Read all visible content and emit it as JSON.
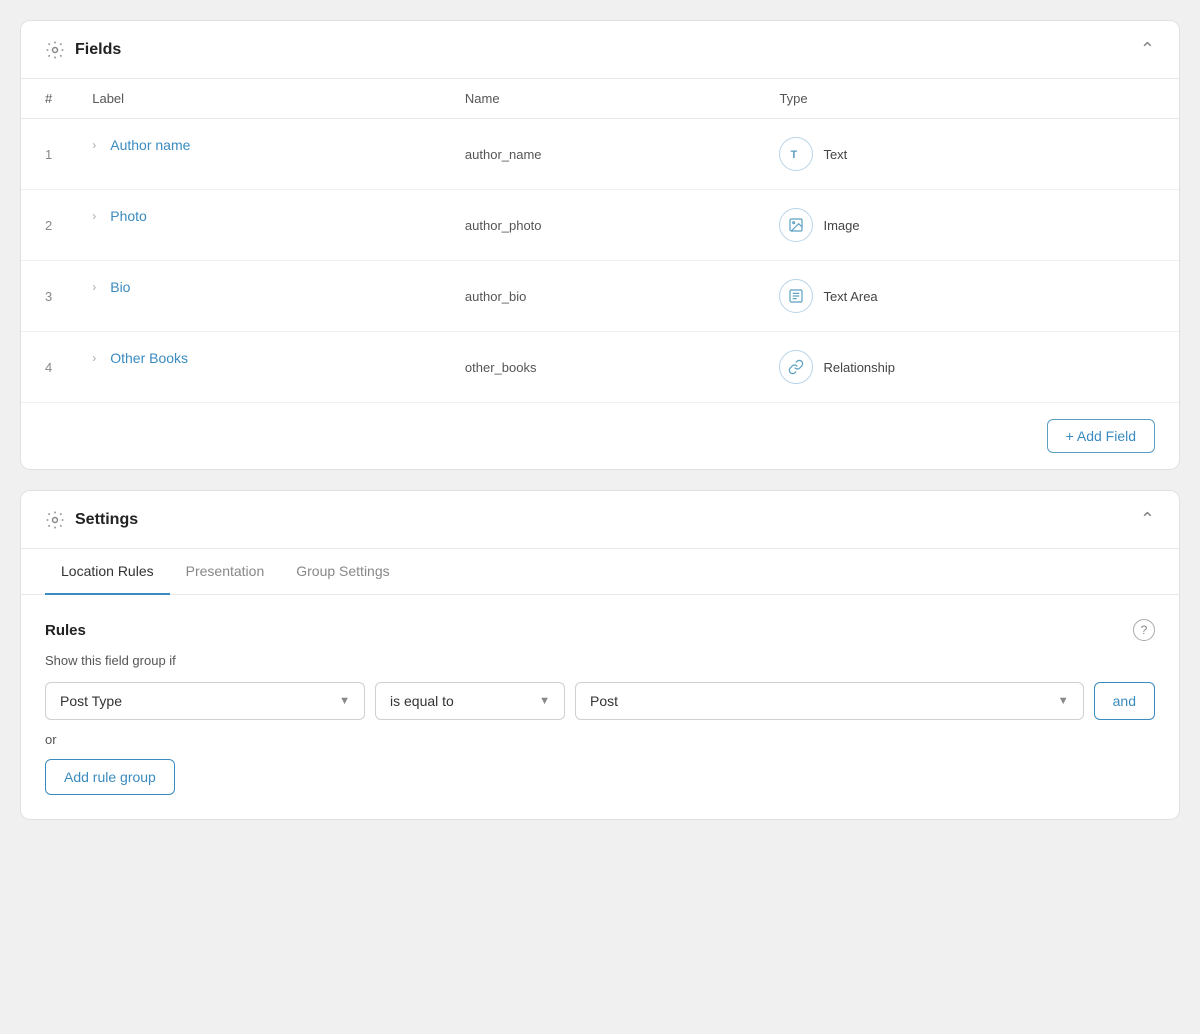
{
  "fields_panel": {
    "title": "Fields",
    "columns": {
      "hash": "#",
      "label": "Label",
      "name": "Name",
      "type": "Type"
    },
    "rows": [
      {
        "number": "1",
        "label": "Author name",
        "name": "author_name",
        "type": "Text",
        "type_icon": "T"
      },
      {
        "number": "2",
        "label": "Photo",
        "name": "author_photo",
        "type": "Image",
        "type_icon": "IMG"
      },
      {
        "number": "3",
        "label": "Bio",
        "name": "author_bio",
        "type": "Text Area",
        "type_icon": "TA"
      },
      {
        "number": "4",
        "label": "Other Books",
        "name": "other_books",
        "type": "Relationship",
        "type_icon": "REL"
      }
    ],
    "add_field_label": "+ Add Field"
  },
  "settings_panel": {
    "title": "Settings",
    "tabs": [
      {
        "label": "Location Rules",
        "active": true
      },
      {
        "label": "Presentation",
        "active": false
      },
      {
        "label": "Group Settings",
        "active": false
      }
    ],
    "rules": {
      "title": "Rules",
      "show_if_label": "Show this field group if",
      "rule_row": {
        "post_type_value": "Post Type",
        "operator_value": "is equal to",
        "value_value": "Post",
        "and_label": "and"
      },
      "or_label": "or",
      "add_rule_group_label": "Add rule group"
    }
  }
}
